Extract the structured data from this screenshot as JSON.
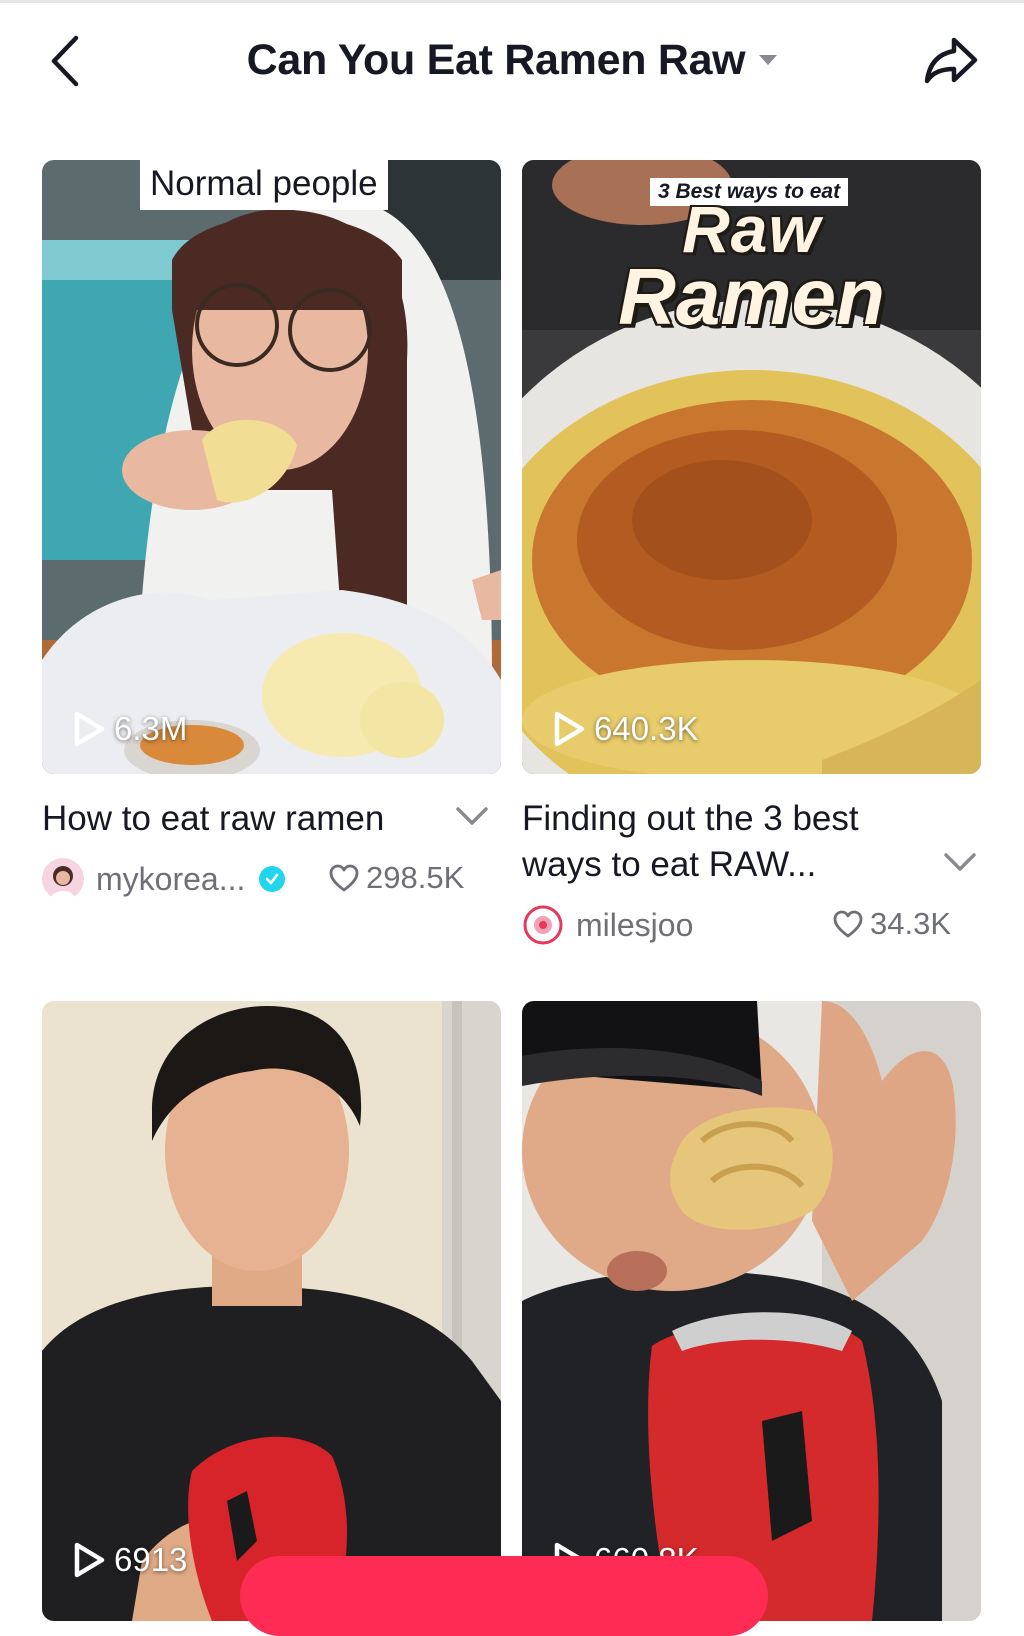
{
  "header": {
    "title": "Can You Eat Ramen Raw",
    "back_icon": "chevron-left-icon",
    "dropdown_icon": "caret-down-icon",
    "share_icon": "share-arrow-icon"
  },
  "videos": [
    {
      "overlay_text": "Normal people",
      "views": "6.3M",
      "description": "How to eat raw ramen",
      "author": "mykorea...",
      "verified": true,
      "likes": "298.5K"
    },
    {
      "overlay_small": "3 Best ways to eat",
      "overlay_big_1": "Raw",
      "overlay_big_2": "Ramen",
      "views": "640.3K",
      "description": "Finding out the 3 best ways to eat RAW...",
      "author": "milesjoo",
      "verified": false,
      "likes": "34.3K"
    },
    {
      "views": "6913"
    },
    {
      "views": "660.8K"
    }
  ],
  "colors": {
    "accent": "#fe2c55",
    "verified": "#20d5ec",
    "text_primary": "#161823",
    "text_secondary": "#6f7077"
  }
}
